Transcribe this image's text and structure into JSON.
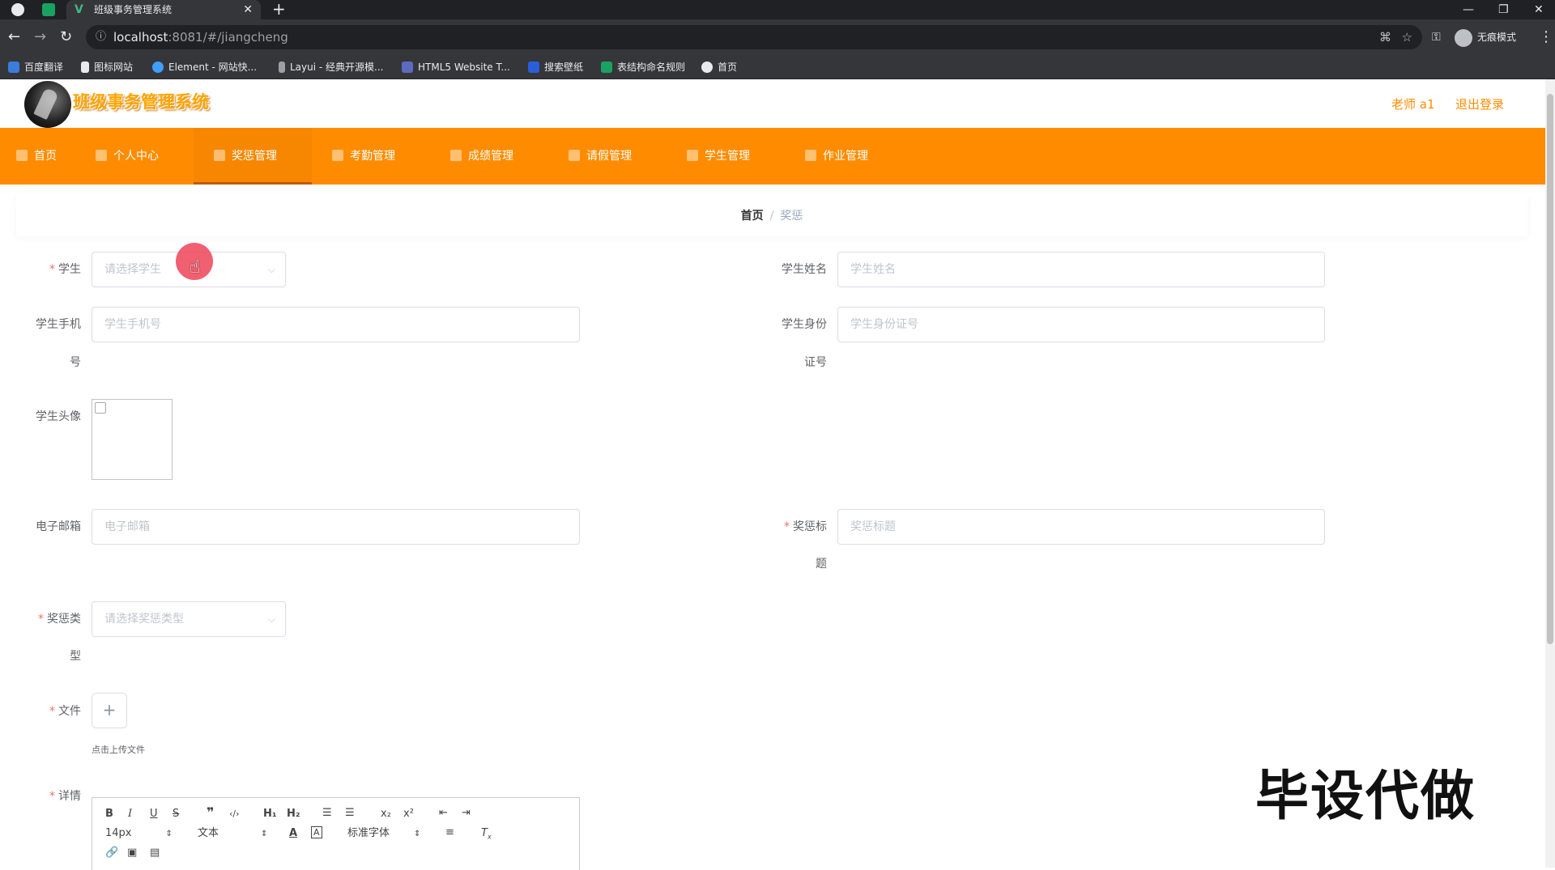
{
  "browser": {
    "tab_title": "班级事务管理系统",
    "url_host": "localhost",
    "url_rest": ":8081/#/jiangcheng",
    "profile_label": "无痕模式",
    "bookmarks": [
      "百度翻译",
      "图标网站",
      "Element - 网站快...",
      "Layui - 经典开源模...",
      "HTML5 Website T...",
      "搜索壁纸",
      "表结构命名规则",
      "首页"
    ]
  },
  "header": {
    "title": "班级事务管理系统",
    "user": "老师 a1",
    "logout": "退出登录"
  },
  "nav": [
    {
      "label": "首页"
    },
    {
      "label": "个人中心"
    },
    {
      "label": "奖惩管理",
      "active": true
    },
    {
      "label": "考勤管理"
    },
    {
      "label": "成绩管理"
    },
    {
      "label": "请假管理"
    },
    {
      "label": "学生管理"
    },
    {
      "label": "作业管理"
    }
  ],
  "breadcrumb": {
    "home": "首页",
    "current": "奖惩"
  },
  "form": {
    "student": {
      "label": "学生",
      "placeholder": "请选择学生"
    },
    "student_name": {
      "label": "学生姓名",
      "placeholder": "学生姓名"
    },
    "phone": {
      "label_line1": "学生手机",
      "label_line2": "号",
      "placeholder": "学生手机号"
    },
    "id_card": {
      "label_line1": "学生身份",
      "label_line2": "证号",
      "placeholder": "学生身份证号"
    },
    "avatar": {
      "label": "学生头像"
    },
    "email": {
      "label": "电子邮箱",
      "placeholder": "电子邮箱"
    },
    "reward_title": {
      "label_line1": "奖惩标",
      "label_line2": "题",
      "placeholder": "奖惩标题"
    },
    "reward_type": {
      "label_line1": "奖惩类",
      "label_line2": "型",
      "placeholder": "请选择奖惩类型"
    },
    "file": {
      "label": "文件",
      "tip": "点击上传文件"
    },
    "detail": {
      "label": "详情"
    }
  },
  "editor": {
    "font_size": "14px",
    "paragraph": "文本",
    "font_family": "标准字体"
  },
  "watermark": "毕设代做"
}
